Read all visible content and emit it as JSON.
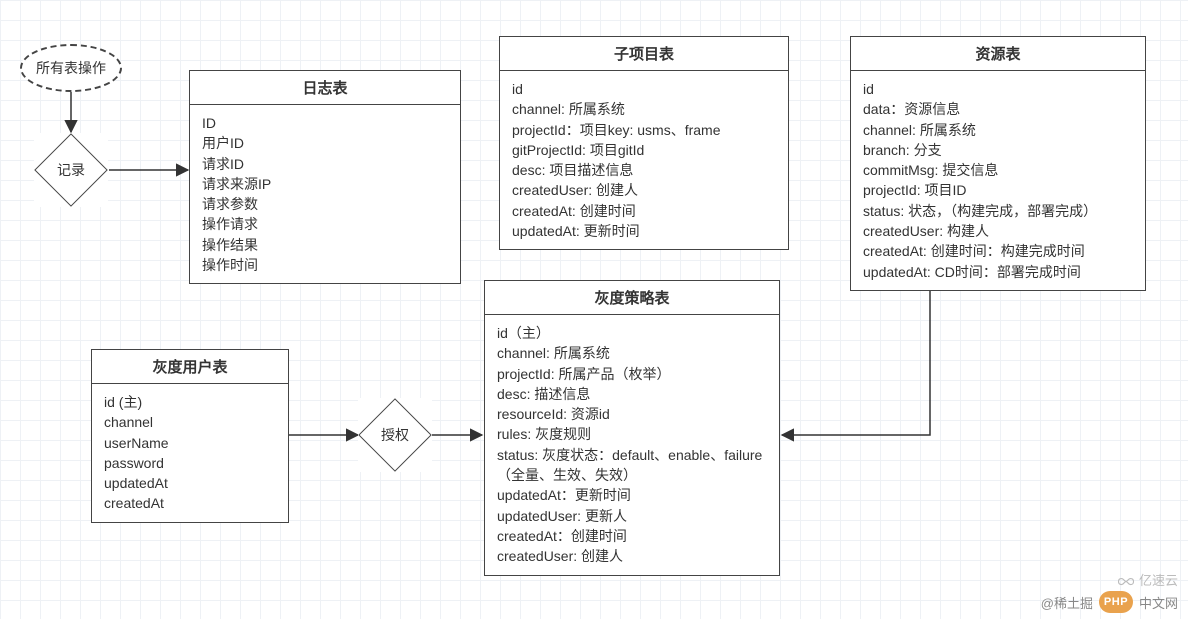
{
  "nodes": {
    "all_ops": {
      "label": "所有表操作"
    },
    "record": {
      "label": "记录"
    },
    "authorize": {
      "label": "授权"
    }
  },
  "tables": {
    "log": {
      "title": "日志表",
      "fields": [
        "ID",
        "用户ID",
        "请求ID",
        "请求来源IP",
        "请求参数",
        "操作请求",
        "操作结果",
        "操作时间"
      ]
    },
    "sub_project": {
      "title": "子项目表",
      "fields": [
        "id",
        "channel: 所属系统",
        "projectId：项目key: usms、frame",
        "gitProjectId: 项目gitId",
        "desc: 项目描述信息",
        "createdUser: 创建人",
        "createdAt: 创建时间",
        "updatedAt: 更新时间"
      ]
    },
    "resource": {
      "title": "资源表",
      "fields": [
        "id",
        "data：资源信息",
        "channel: 所属系统",
        "branch: 分支",
        "commitMsg: 提交信息",
        "projectId: 项目ID",
        "status: 状态，（构建完成，部署完成）",
        "createdUser: 构建人",
        "createdAt: 创建时间：构建完成时间",
        "updatedAt: CD时间：部署完成时间"
      ]
    },
    "gray_user": {
      "title": "灰度用户表",
      "fields": [
        "id (主)",
        "channel",
        "userName",
        "password",
        "updatedAt",
        "createdAt"
      ]
    },
    "gray_strategy": {
      "title": "灰度策略表",
      "fields": [
        "id（主）",
        "channel: 所属系统",
        "projectId: 所属产品（枚举）",
        "desc: 描述信息",
        "resourceId: 资源id",
        "rules: 灰度规则",
        "status: 灰度状态：default、enable、failure（全量、生效、失效）",
        "updatedAt：更新时间",
        "updatedUser: 更新人",
        "createdAt：创建时间",
        "createdUser: 创建人"
      ]
    }
  },
  "watermark": {
    "xitu": "@稀土掘",
    "php": "PHP",
    "zhongwen": "中文网",
    "yisu": "亿速云"
  }
}
